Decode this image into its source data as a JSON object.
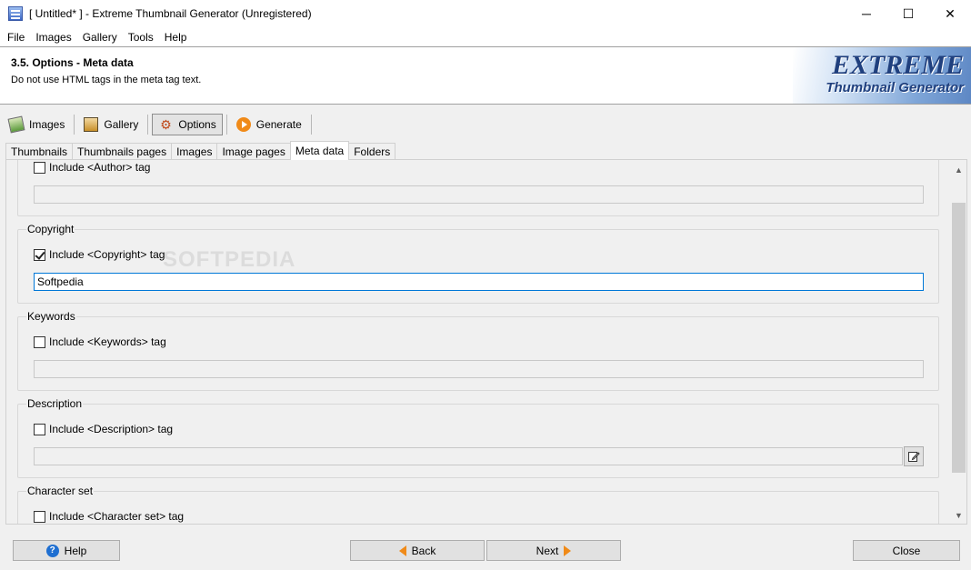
{
  "window": {
    "title": "[ Untitled* ] - Extreme Thumbnail Generator (Unregistered)",
    "minimize": "─",
    "maximize": "☐",
    "close": "✕"
  },
  "menu": [
    "File",
    "Images",
    "Gallery",
    "Tools",
    "Help"
  ],
  "header": {
    "title": "3.5. Options - Meta data",
    "subtitle": "Do not use HTML tags in the meta tag text.",
    "logo_line1": "EXTREME",
    "logo_line2": "Thumbnail Generator"
  },
  "toolbar": {
    "images": "Images",
    "gallery": "Gallery",
    "options": "Options",
    "generate": "Generate"
  },
  "tabs": [
    "Thumbnails",
    "Thumbnails pages",
    "Images",
    "Image pages",
    "Meta data",
    "Folders"
  ],
  "active_tab": "Meta data",
  "author": {
    "label": "Include <Author> tag",
    "checked": false,
    "value": ""
  },
  "copyright": {
    "group": "Copyright",
    "label": "Include <Copyright> tag",
    "checked": true,
    "value": "Softpedia"
  },
  "keywords": {
    "group": "Keywords",
    "label": "Include <Keywords> tag",
    "checked": false,
    "value": ""
  },
  "description": {
    "group": "Description",
    "label": "Include <Description> tag",
    "checked": false,
    "value": ""
  },
  "charset": {
    "group": "Character set",
    "label": "Include <Character set> tag",
    "checked": false
  },
  "watermark": "SOFTPEDIA",
  "footer": {
    "help": "Help",
    "back": "Back",
    "next": "Next",
    "close": "Close"
  },
  "scroll_arrows": {
    "up": "▲",
    "down": "▼"
  }
}
